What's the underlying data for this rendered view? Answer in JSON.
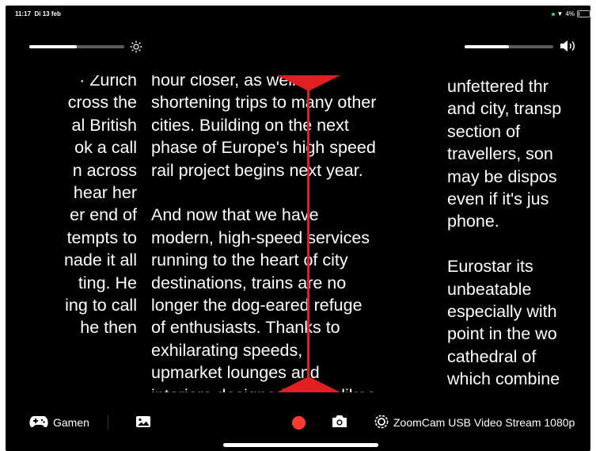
{
  "status": {
    "time": "11:17",
    "date": "Di 13 feb",
    "battery": "4%"
  },
  "controls": {
    "brightness_level": 0.5,
    "volume_level": 0.5
  },
  "video": {
    "col1": [
      "· Zurich",
      "cross the",
      "al British",
      "ok a call",
      "n across",
      "hear her",
      "er end of",
      "tempts to",
      "nade it all",
      "ting. He",
      "ing to call",
      "he then"
    ],
    "col2": [
      "hour closer, as well as",
      "shortening trips to many other",
      "cities. Building on the next",
      "phase of Europe's high speed",
      "rail project begins next year.",
      "",
      "And now that we have",
      "modern, high-speed services",
      "running to the heart of city",
      "destinations, trains are no",
      "longer the dog-eared refuge",
      "of enthusiasts. Thanks to",
      "exhilarating speeds,",
      "upmarket lounges and",
      "interiors designed by the likes"
    ],
    "col3": [
      "unfettered thr",
      "and city, transp",
      "section of",
      "travellers, son",
      "may be dispos",
      "even if it's jus",
      "phone.",
      "",
      "Eurostar its",
      "unbeatable",
      "especially with",
      "point in the wo",
      "cathedral of",
      "which combine"
    ]
  },
  "toolbar": {
    "gamen_label": "Gamen",
    "camera_label": "ZoomCam USB Video Stream 1080p"
  },
  "colors": {
    "record": "#ff3b30",
    "guide": "#e02020",
    "battery_dot": "#32d74b"
  }
}
